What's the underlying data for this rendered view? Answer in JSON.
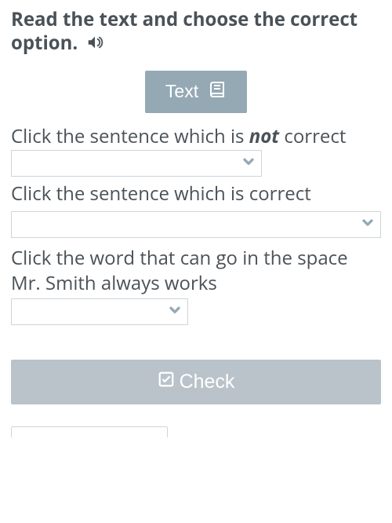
{
  "instruction": "Read the text and choose the correct option.",
  "text_button_label": "Text",
  "q1": {
    "prefix": "Click the sentence which is ",
    "em": "not",
    "suffix": " correct"
  },
  "q2": "Click the sentence which is correct",
  "q3": "Click the word that can go in the space Mr. Smith always works",
  "check_label": "Check",
  "colors": {
    "text": "#4a5258",
    "button_bg": "#95a9b5",
    "check_bg": "#b9c3c9",
    "chevron": "#95a9b5"
  }
}
